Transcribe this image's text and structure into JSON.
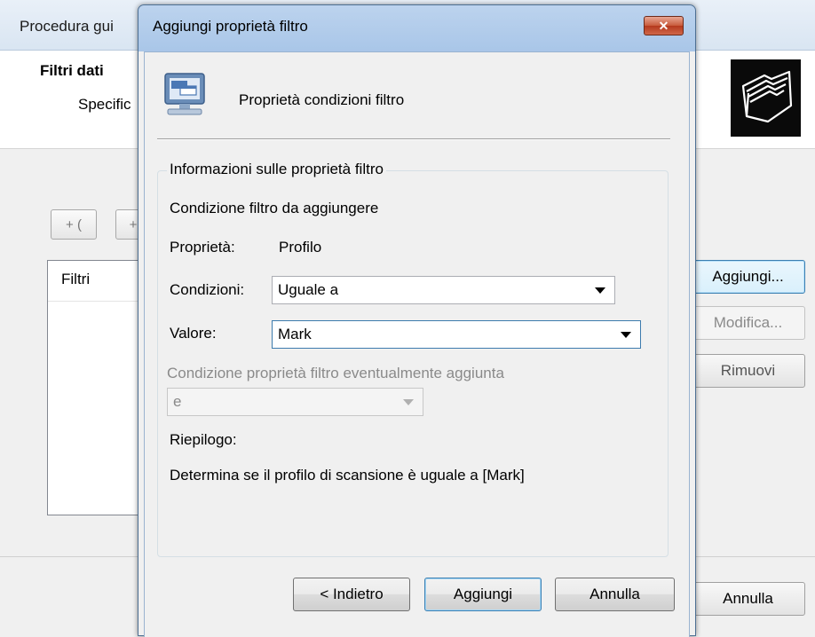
{
  "background_window": {
    "title": "Procedura gui",
    "heading": "Filtri dati",
    "subheading": "Specific",
    "toolbar_buttons": [
      "+ (",
      "+"
    ],
    "list_header": "Filtri",
    "side_buttons": {
      "add": "Aggiungi...",
      "edit": "Modifica...",
      "remove": "Rimuovi"
    },
    "footer_cancel": "Annulla",
    "icon": "folders-icon"
  },
  "dialog": {
    "title": "Aggiungi proprietà filtro",
    "close_icon": "close-icon",
    "heading_icon": "computer-icon",
    "heading": "Proprietà condizioni filtro",
    "group_label": "Informazioni sulle proprietà filtro",
    "condition_to_add_label": "Condizione filtro da aggiungere",
    "property_label": "Proprietà:",
    "property_value": "Profilo",
    "conditions_label": "Condizioni:",
    "conditions_value": "Uguale a",
    "value_label": "Valore:",
    "value_value": "Mark",
    "additional_condition_label": "Condizione proprietà filtro eventualmente aggiunta",
    "additional_condition_value": "e",
    "summary_label": "Riepilogo:",
    "summary_text": "Determina se il profilo di scansione è uguale a [Mark]",
    "buttons": {
      "back": "< Indietro",
      "add": "Aggiungi",
      "cancel": "Annulla"
    }
  }
}
